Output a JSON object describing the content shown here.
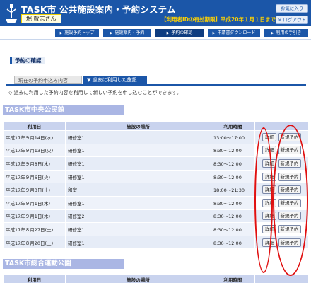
{
  "header": {
    "title": "TASK市 公共施設案内・予約システム",
    "user": "堀 敬志さん",
    "validity": "【利用者IDの有効期限】平成20年１月１日まで",
    "favorites_label": "お気に入り",
    "logout_label": "× ログアウト"
  },
  "nav": {
    "tabs": [
      {
        "label": "施設予約トップ"
      },
      {
        "label": "施設案内・予約"
      },
      {
        "label": "予約の確認"
      },
      {
        "label": "申請書ダウンロード"
      },
      {
        "label": "利用の手引き"
      }
    ]
  },
  "page": {
    "heading": "予約の確認",
    "subtab_current": "現在の予約申込み内容",
    "subtab_past": "▼ 過去に利用した施設",
    "description": "◇ 過去に利用した予約内容を利用して新しい予約を申し込むことができます。"
  },
  "buttons": {
    "detail": "詳細",
    "new_reservation": "新規予約"
  },
  "facilities": [
    {
      "name": "TASK市中央公民館",
      "columns": [
        "利用日",
        "施設の場所",
        "利用時間",
        ""
      ],
      "rows": [
        {
          "date": "平成17年９月14日(水)",
          "room": "研修室1",
          "time": "13:00～17:00"
        },
        {
          "date": "平成17年９月13日(火)",
          "room": "研修室1",
          "time": "8:30～12:00"
        },
        {
          "date": "平成17年９月8日(木)",
          "room": "研修室1",
          "time": "8:30～12:00"
        },
        {
          "date": "平成17年９月6日(火)",
          "room": "研修室1",
          "time": "8:30～12:00"
        },
        {
          "date": "平成17年９月3日(土)",
          "room": "和室",
          "time": "18:00～21:30"
        },
        {
          "date": "平成17年９月1日(木)",
          "room": "研修室1",
          "time": "8:30～12:00"
        },
        {
          "date": "平成17年９月1日(木)",
          "room": "研修室2",
          "time": "8:30～12:00"
        },
        {
          "date": "平成17年８月27日(土)",
          "room": "研修室1",
          "time": "8:30～12:00"
        },
        {
          "date": "平成17年８月20日(土)",
          "room": "研修室1",
          "time": "8:30～12:00"
        }
      ]
    },
    {
      "name": "TASK市総合運動公園",
      "columns": [
        "利用日",
        "施設の場所",
        "利用時間",
        ""
      ]
    }
  ],
  "colors": {
    "header_blue": "#1b56a8",
    "section_bar": "#aab6e4",
    "annotation_red": "#e01010"
  }
}
